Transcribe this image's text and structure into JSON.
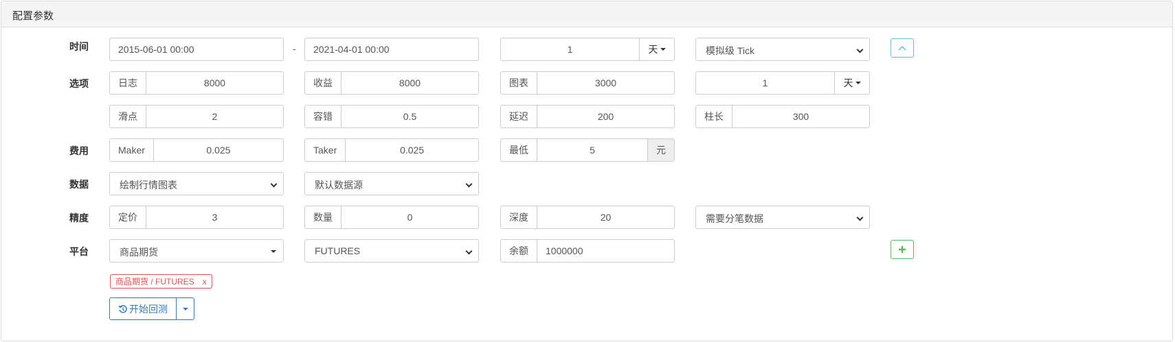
{
  "panel": {
    "title": "配置参数"
  },
  "rows": {
    "time": "时间",
    "options": "选项",
    "fee": "费用",
    "data": "数据",
    "precision": "精度",
    "platform": "平台"
  },
  "time": {
    "start": "2015-06-01 00:00",
    "separator": "-",
    "end": "2021-04-01 00:00",
    "period_value": "1",
    "period_unit": "天",
    "mode": "模拟级 Tick"
  },
  "options": {
    "log_label": "日志",
    "log_value": "8000",
    "profit_label": "收益",
    "profit_value": "8000",
    "chart_label": "图表",
    "chart_value": "3000",
    "kline_value": "1",
    "kline_unit": "天",
    "slippage_label": "滑点",
    "slippage_value": "2",
    "tolerance_label": "容错",
    "tolerance_value": "0.5",
    "delay_label": "延迟",
    "delay_value": "200",
    "bar_label": "柱长",
    "bar_value": "300"
  },
  "fee": {
    "maker_label": "Maker",
    "maker_value": "0.025",
    "taker_label": "Taker",
    "taker_value": "0.025",
    "min_label": "最低",
    "min_value": "5",
    "min_unit": "元"
  },
  "data": {
    "chart_select": "绘制行情图表",
    "source_select": "默认数据源"
  },
  "precision": {
    "price_label": "定价",
    "price_value": "3",
    "qty_label": "数量",
    "qty_value": "0",
    "depth_label": "深度",
    "depth_value": "20",
    "tick_select": "需要分笔数据"
  },
  "platform": {
    "exchange": "商品期货",
    "market": "FUTURES",
    "balance_label": "余额",
    "balance_value": "1000000"
  },
  "tag": {
    "text": "商品期货 / FUTURES",
    "remove": "x"
  },
  "run": {
    "label": "开始回测"
  },
  "colors": {
    "primary": "#337ab7",
    "success": "#5cb85c",
    "info": "#5bc0de",
    "danger": "#d9534f"
  }
}
